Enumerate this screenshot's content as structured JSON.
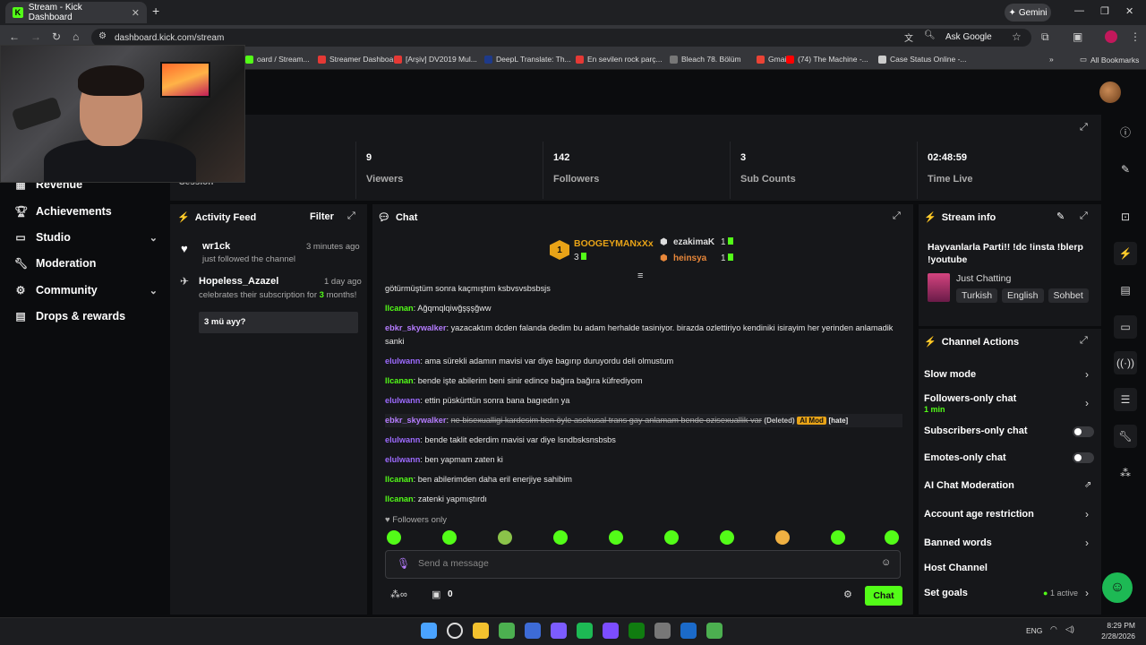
{
  "browser": {
    "tab_title": "Stream - Kick Dashboard",
    "url": "dashboard.kick.com/stream",
    "gemini_label": "Gemini",
    "ask_google": "Ask Google",
    "bookmarks": [
      {
        "label": "oard / Stream...",
        "color": "#53fc18"
      },
      {
        "label": "Streamer Dashboard",
        "color": "#e53935"
      },
      {
        "label": "[Arşiv] DV2019 Mul...",
        "color": "#e53935"
      },
      {
        "label": "DeepL Translate: Th...",
        "color": "#1e3a8a"
      },
      {
        "label": "En sevilen rock parç...",
        "color": "#e53935"
      },
      {
        "label": "Bleach 78. Bölüm",
        "color": "#777"
      },
      {
        "label": "Gmail",
        "color": "#ea4335"
      },
      {
        "label": "(74) The Machine -...",
        "color": "#ff0000"
      },
      {
        "label": "Case Status Online -...",
        "color": "#ccc"
      }
    ],
    "all_bookmarks": "All Bookmarks"
  },
  "sidebar": {
    "items": [
      {
        "label": "Revenue",
        "icon": "dollar-icon",
        "expandable": false
      },
      {
        "label": "Achievements",
        "icon": "trophy-icon",
        "expandable": false
      },
      {
        "label": "Studio",
        "icon": "studio-icon",
        "expandable": true
      },
      {
        "label": "Moderation",
        "icon": "wrench-icon",
        "expandable": false
      },
      {
        "label": "Community",
        "icon": "community-icon",
        "expandable": true
      },
      {
        "label": "Drops & rewards",
        "icon": "gift-icon",
        "expandable": false
      }
    ]
  },
  "stats": {
    "session_label": "Session",
    "items": [
      {
        "value": "9",
        "label": "Viewers"
      },
      {
        "value": "142",
        "label": "Followers"
      },
      {
        "value": "3",
        "label": "Sub Counts"
      },
      {
        "value": "02:48:59",
        "label": "Time Live"
      }
    ]
  },
  "activity": {
    "title": "Activity Feed",
    "filter": "Filter",
    "items": [
      {
        "user": "wr1ck",
        "time": "3 minutes ago",
        "text": "just followed the channel"
      },
      {
        "user": "Hopeless_Azazel",
        "time": "1 day ago",
        "text_pre": "celebrates their subscription for ",
        "text_num": "3",
        "text_post": " months!",
        "message": "3 mü ayy?"
      }
    ]
  },
  "chat": {
    "title": "Chat",
    "leaderboard": {
      "first_user": "BOOGEYMANxXx",
      "first_count": "3",
      "rank_badge": "1",
      "second_user": "ezakimaK",
      "second_count": "1",
      "third_user": "heinsya",
      "third_count": "1"
    },
    "messages": [
      {
        "user": "",
        "text": "götürmüştüm sonra kaçmıştım ksbvsvsbsbsjs",
        "color": "#53fc18"
      },
      {
        "user": "llcanan",
        "text": "Ağqmqlqiwğşşşğww",
        "color": "#53fc18"
      },
      {
        "user": "ebkr_skywalker",
        "text": "yazacaktım dcden falanda dedim bu adam herhalde tasiniyor. birazda ozlettiriyo kendiniki isirayim her yerinden anlamadik sanki",
        "color": "#b57cff"
      },
      {
        "user": "elulwann",
        "text": "ama sürekli adamın mavisi var diye bagırıp duruyordu deli olmustum",
        "color": "#9d6bff"
      },
      {
        "user": "llcanan",
        "text": "bende işte abilerim beni sinir edince bağıra bağıra küfrediyom",
        "color": "#53fc18"
      },
      {
        "user": "elulwann",
        "text": "ettin püskürttün sonra bana bagıedın ya",
        "color": "#9d6bff"
      },
      {
        "user": "ebkr_skywalker",
        "text": "ne bisexualligi kardesim ben öyle asekusal trans gay anlamam bende ozisexuallik var",
        "color": "#b57cff",
        "deleted": true,
        "deleted_label": "(Deleted)",
        "aimod": "AI Mod",
        "reason": "[hate]"
      },
      {
        "user": "elulwann",
        "text": "bende taklit ederdim mavisi var diye lsndbsksnsbsbs",
        "color": "#9d6bff"
      },
      {
        "user": "elulwann",
        "text": "ben yapmam zaten ki",
        "color": "#9d6bff"
      },
      {
        "user": "llcanan",
        "text": "ben abilerimden daha eril enerjiye sahibim",
        "color": "#53fc18"
      },
      {
        "user": "llcanan",
        "text": "zatenki yapmıştırdı",
        "color": "#53fc18"
      }
    ],
    "followers_only": "Followers only",
    "input_placeholder": "Send a message",
    "points": "0",
    "send_label": "Chat"
  },
  "stream_info": {
    "title": "Stream info",
    "stream_title": "Hayvanlarla Parti!! !dc !insta !blerp !youtube",
    "category": "Just Chatting",
    "tags": [
      "Turkish",
      "English",
      "Sohbet"
    ]
  },
  "channel_actions": {
    "title": "Channel Actions",
    "slow_mode": "Slow mode",
    "followers_only": "Followers-only chat",
    "followers_only_value": "1 min",
    "subscribers_only": "Subscribers-only chat",
    "emotes_only": "Emotes-only chat",
    "ai_moderation": "AI Chat Moderation",
    "account_age": "Account age restriction",
    "banned_words": "Banned words",
    "host_channel": "Host Channel",
    "set_goals": "Set goals",
    "goals_status": "1 active"
  },
  "taskbar": {
    "lang": "ENG",
    "time": "8:29 PM",
    "date": "2/28/2026"
  },
  "colors": {
    "accent": "#53fc18",
    "panel": "#16171a",
    "background": "#0b0c0e"
  }
}
